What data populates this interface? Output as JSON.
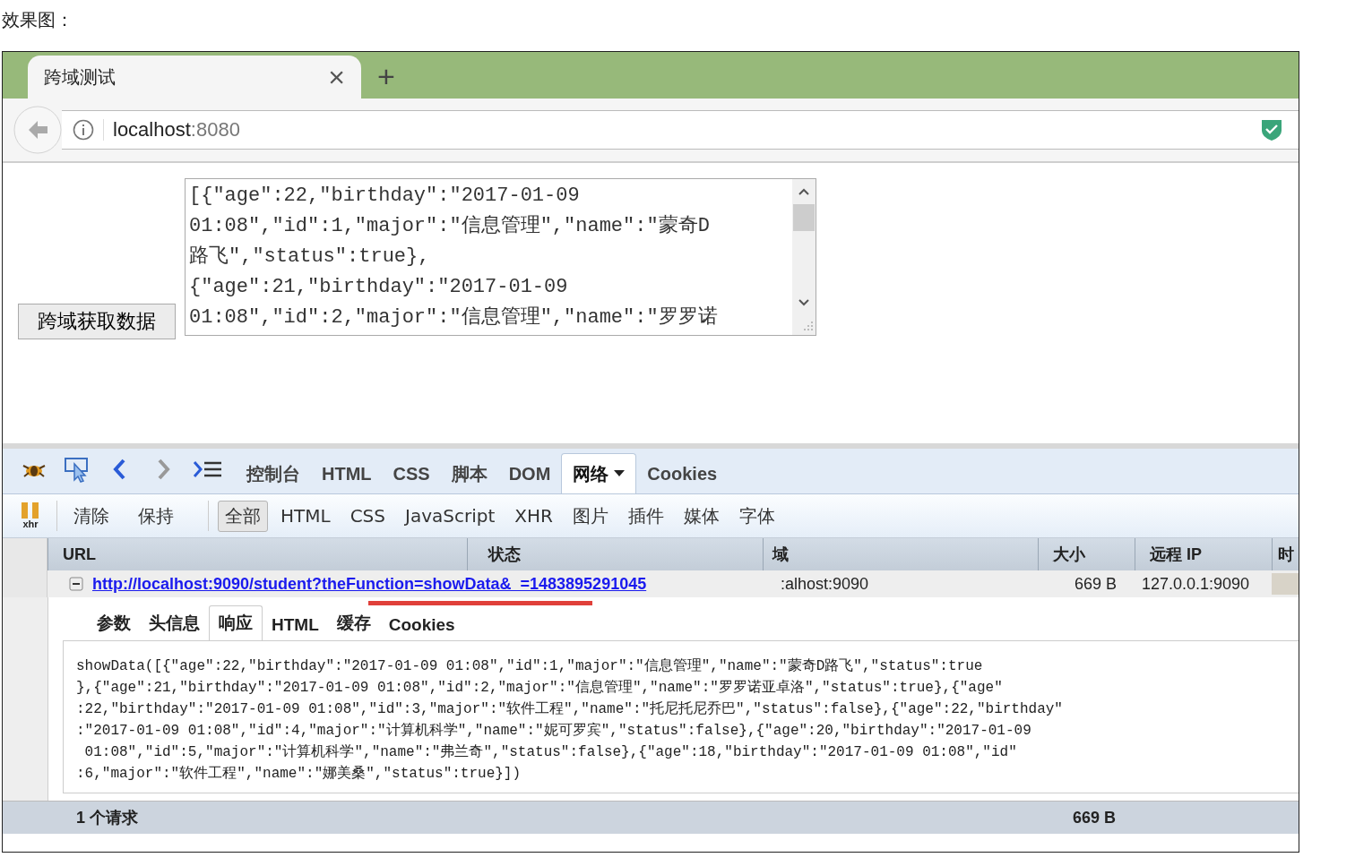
{
  "caption": "效果图：",
  "browser": {
    "tab": {
      "title": "跨域测试",
      "close": "×"
    },
    "new_tab": "+",
    "address": {
      "host": "localhost",
      "port": ":8080"
    }
  },
  "page": {
    "button": "跨域获取数据",
    "textarea_lines": [
      "[{\"age\":22,\"birthday\":\"2017-01-09",
      "01:08\",\"id\":1,\"major\":\"信息管理\",\"name\":\"蒙奇D",
      "路飞\",\"status\":true},",
      "{\"age\":21,\"birthday\":\"2017-01-09",
      "01:08\",\"id\":2,\"major\":\"信息管理\",\"name\":\"罗罗诺"
    ]
  },
  "devtools": {
    "panel_tabs": [
      {
        "label": "控制台",
        "selected": false,
        "dropdown": false
      },
      {
        "label": "HTML",
        "selected": false,
        "dropdown": false
      },
      {
        "label": "CSS",
        "selected": false,
        "dropdown": false
      },
      {
        "label": "脚本",
        "selected": false,
        "dropdown": false
      },
      {
        "label": "DOM",
        "selected": false,
        "dropdown": false
      },
      {
        "label": "网络",
        "selected": true,
        "dropdown": true
      },
      {
        "label": "Cookies",
        "selected": false,
        "dropdown": false
      }
    ],
    "xhr_label": "xhr",
    "net_actions": [
      "清除",
      "保持"
    ],
    "filters": [
      {
        "label": "全部",
        "selected": true
      },
      {
        "label": "HTML",
        "selected": false
      },
      {
        "label": "CSS",
        "selected": false
      },
      {
        "label": "JavaScript",
        "selected": false
      },
      {
        "label": "XHR",
        "selected": false
      },
      {
        "label": "图片",
        "selected": false
      },
      {
        "label": "插件",
        "selected": false
      },
      {
        "label": "媒体",
        "selected": false
      },
      {
        "label": "字体",
        "selected": false
      }
    ],
    "columns": [
      "URL",
      "状态",
      "域",
      "大小",
      "远程 IP",
      "时"
    ],
    "request": {
      "expanded": true,
      "url": "http://localhost:9090/student?theFunction=showData&_=1483895291045",
      "domain": ":alhost:9090",
      "size": "669 B",
      "remote_ip": "127.0.0.1:9090"
    },
    "detail_tabs": [
      {
        "label": "参数",
        "selected": false
      },
      {
        "label": "头信息",
        "selected": false
      },
      {
        "label": "响应",
        "selected": true
      },
      {
        "label": "HTML",
        "selected": false
      },
      {
        "label": "缓存",
        "selected": false
      },
      {
        "label": "Cookies",
        "selected": false
      }
    ],
    "response_lines": [
      "showData([{\"age\":22,\"birthday\":\"2017-01-09 01:08\",\"id\":1,\"major\":\"信息管理\",\"name\":\"蒙奇D路飞\",\"status\":true",
      "},{\"age\":21,\"birthday\":\"2017-01-09 01:08\",\"id\":2,\"major\":\"信息管理\",\"name\":\"罗罗诺亚卓洛\",\"status\":true},{\"age\"",
      ":22,\"birthday\":\"2017-01-09 01:08\",\"id\":3,\"major\":\"软件工程\",\"name\":\"托尼托尼乔巴\",\"status\":false},{\"age\":22,\"birthday\"",
      ":\"2017-01-09 01:08\",\"id\":4,\"major\":\"计算机科学\",\"name\":\"妮可罗宾\",\"status\":false},{\"age\":20,\"birthday\":\"2017-01-09",
      " 01:08\",\"id\":5,\"major\":\"计算机科学\",\"name\":\"弗兰奇\",\"status\":false},{\"age\":18,\"birthday\":\"2017-01-09 01:08\",\"id\"",
      ":6,\"major\":\"软件工程\",\"name\":\"娜美桑\",\"status\":true}])"
    ],
    "footer": {
      "count": "1 个请求",
      "size": "669 B"
    }
  }
}
